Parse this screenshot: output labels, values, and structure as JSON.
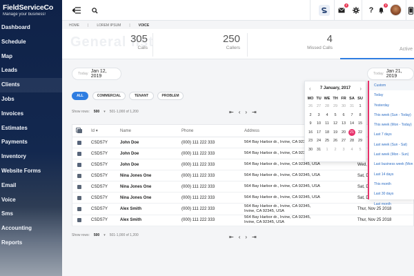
{
  "app": {
    "name": "FieldServiceCo",
    "tagline": "Manage your business!"
  },
  "sidebar": {
    "items": [
      {
        "label": "Dashboard"
      },
      {
        "label": "Schedule"
      },
      {
        "label": "Map"
      },
      {
        "label": "Leads"
      },
      {
        "label": "Clients"
      },
      {
        "label": "Jobs"
      },
      {
        "label": "Invoices"
      },
      {
        "label": "Estimates"
      },
      {
        "label": "Payments"
      },
      {
        "label": "Inventory"
      },
      {
        "label": "Website Forms"
      },
      {
        "label": "Email"
      },
      {
        "label": "Voice"
      },
      {
        "label": "Sms"
      },
      {
        "label": "Accounting"
      },
      {
        "label": "Reports"
      }
    ]
  },
  "topbar": {
    "icons": [
      "collapse-menu-icon",
      "search-icon",
      "brand-s-icon",
      "mail-icon",
      "gear-icon",
      "help-icon",
      "bell-icon",
      "avatar",
      "phone-icon"
    ],
    "mail_badge": "2",
    "bell_badge": "3"
  },
  "breadcrumb": [
    "HOME",
    "LOREM IPSUM",
    "VOICE"
  ],
  "stats": {
    "ghost_title": "General list",
    "items": [
      {
        "value": "305",
        "label": "Calls"
      },
      {
        "value": "250",
        "label": "Callers"
      },
      {
        "value": "4",
        "label": "Missed Calls"
      }
    ],
    "active_label": "Active"
  },
  "date_from": {
    "caption": "Today",
    "value": "Jan 12, 2019"
  },
  "date_to": {
    "caption": "Today",
    "value": "Jan 21, 2019"
  },
  "filters": [
    "ALL",
    "COMMERCIAL",
    "TENANT",
    "PROBLEM"
  ],
  "pager_top": {
    "show_rows_label": "Show rows:",
    "rows": "500",
    "range": "501-1,000 of 1,200"
  },
  "pager_bottom": {
    "show_rows_label": "Show rows:",
    "rows": "500",
    "range": "501-1,000 of 1,200"
  },
  "table": {
    "headers": {
      "id": "Id",
      "name": "Name",
      "phone": "Phone",
      "address": "Address"
    },
    "rows": [
      {
        "checked": true,
        "id": "CSDS7Y",
        "name": "John Doe",
        "phone": "(000) 111 222 333",
        "address": "564 Bay Harbor dr., Irvine, CA 92345, USA",
        "address2": "",
        "date": ""
      },
      {
        "checked": true,
        "id": "CSDS7Y",
        "name": "John Doe",
        "phone": "(000) 111 222 333",
        "address": "564 Bay Harbor dr., Irvine, CA 92345, USA",
        "address2": "",
        "date": ""
      },
      {
        "checked": true,
        "id": "CSDS7Y",
        "name": "John Doe",
        "phone": "(000) 111 222 333",
        "address": "564 Bay Harbor dr., Irvine, CA 92345, USA",
        "address2": "",
        "date": "Wed,"
      },
      {
        "checked": false,
        "id": "CSDS7Y",
        "name": "Nina Jones One",
        "phone": "(000) 111 222 333",
        "address": "564 Bay Harbor dr., Irvine, CA 92345, USA",
        "address2": "",
        "date": "Sat, D"
      },
      {
        "checked": false,
        "id": "CSDS7Y",
        "name": "Nina Jones One",
        "phone": "(000) 111 222 333",
        "address": "564 Bay Harbor dr., Irvine, CA 92345, USA",
        "address2": "",
        "date": "Sat, D"
      },
      {
        "checked": false,
        "id": "CSDS7Y",
        "name": "Nina Jones One",
        "phone": "(000) 111 222 333",
        "address": "564 Bay Harbor dr., Irvine, CA 92345, USA",
        "address2": "",
        "date": "Sat, D"
      },
      {
        "checked": false,
        "id": "CSDS7Y",
        "name": "Alex Smith",
        "phone": "(000) 111 222 333",
        "address": "564 Bay Harbor dr., Irvine, CA 92345,",
        "address2": "Irvine, CA 92345, USA",
        "date": "Thur, Nov 25 2018"
      },
      {
        "checked": false,
        "id": "CSDS7Y",
        "name": "Alex Smith",
        "phone": "(000) 111 222 333",
        "address": "564 Bay Harbor dr., Irvine, CA 92345,",
        "address2": "Irvine, CA 92345, USA",
        "date": "Thur, Nov 25 2018"
      }
    ]
  },
  "calendar": {
    "month_label": "7 January, 2017",
    "dow": [
      "MO",
      "TU",
      "WE",
      "TH",
      "FR",
      "SA",
      "SU"
    ],
    "weeks": [
      [
        "26",
        "27",
        "28",
        "29",
        "30",
        "31",
        "1"
      ],
      [
        "2",
        "3",
        "4",
        "5",
        "6",
        "7",
        "8"
      ],
      [
        "9",
        "10",
        "11",
        "12",
        "13",
        "14",
        "15"
      ],
      [
        "16",
        "17",
        "18",
        "19",
        "20",
        "21",
        "22"
      ],
      [
        "23",
        "24",
        "25",
        "26",
        "27",
        "28",
        "29"
      ],
      [
        "30",
        "31",
        "1",
        "2",
        "3",
        "4",
        "5"
      ]
    ],
    "selected": "21"
  },
  "ranges": [
    "Custom",
    "Today",
    "Yesterday",
    "This week (Sun - Today)",
    "This week (Mon - Today)",
    "Last 7 days",
    "Last week (Sun - Sat)",
    "Last week (Mon - Sun)",
    "Last business week (Mon - Fri)",
    "Last 14 days",
    "This month",
    "Last 30 days",
    "Last month"
  ],
  "colors": {
    "accent": "#2e7de1",
    "highlight": "#e8306a",
    "sidebar": "#13284f"
  }
}
